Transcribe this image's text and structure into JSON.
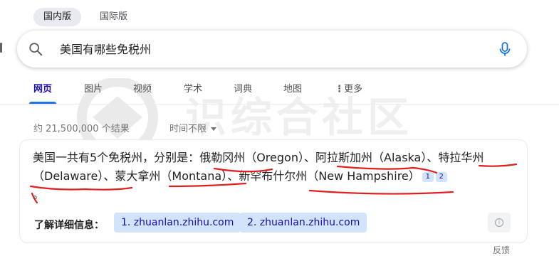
{
  "region_tabs": {
    "active": "国内版",
    "inactive": "国际版"
  },
  "search": {
    "query": "美国有哪些免税州"
  },
  "nav": {
    "tabs": [
      "网页",
      "图片",
      "视频",
      "学术",
      "词典",
      "地图"
    ],
    "more": "更多"
  },
  "stats": {
    "result_count": "约 21,500,000 个结果",
    "time_filter": "时间不限"
  },
  "answer": {
    "prefix": "美国一共有5个免税州，分别是：",
    "states": [
      {
        "zh": "俄勒冈州",
        "en": "（Oregon）"
      },
      {
        "zh": "阿拉斯加州",
        "en": "（Alaska）"
      },
      {
        "zh": "特拉华州",
        "en": "（Delaware）"
      },
      {
        "zh": "蒙大拿州",
        "en": "（Montana）"
      },
      {
        "zh": "新罕布什尔州",
        "en": "（New Hampshire）"
      }
    ],
    "separator": "、",
    "end": "。",
    "citations": [
      "1",
      "2"
    ]
  },
  "learn_more": {
    "label": "了解详细信息：",
    "sources": [
      "1. zhuanlan.zhihu.com",
      "2. zhuanlan.zhihu.com"
    ]
  },
  "feedback": "反馈",
  "watermark": "识综合社区",
  "colors": {
    "link": "#1a0dab",
    "accent": "#1a73e8",
    "chip": "#d2e3fc",
    "annotation": "#e0201e"
  }
}
